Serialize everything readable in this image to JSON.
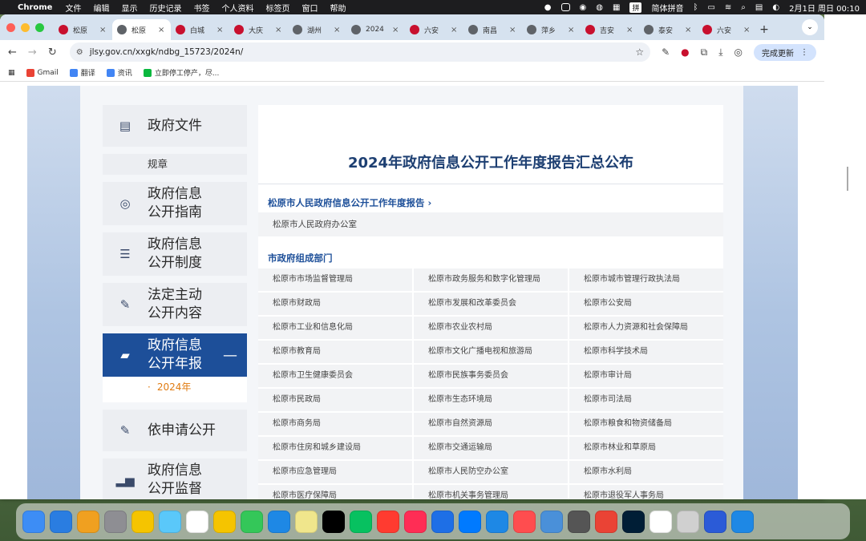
{
  "menubar": {
    "app_name": "Chrome",
    "menus": [
      "文件",
      "编辑",
      "显示",
      "历史记录",
      "书签",
      "个人资料",
      "标签页",
      "窗口",
      "帮助"
    ],
    "input_method": "拼",
    "input_label": "简体拼音",
    "clock": "2月1日 周日  00:10"
  },
  "tabs": [
    {
      "label": "松原",
      "color": "#c8102e"
    },
    {
      "label": "松原",
      "color": "#5f6368",
      "active": true
    },
    {
      "label": "白城",
      "color": "#c8102e"
    },
    {
      "label": "大庆",
      "color": "#c8102e"
    },
    {
      "label": "湖州",
      "color": "#5f6368"
    },
    {
      "label": "2024",
      "color": "#5f6368"
    },
    {
      "label": "六安",
      "color": "#c8102e"
    },
    {
      "label": "南昌",
      "color": "#5f6368"
    },
    {
      "label": "萍乡",
      "color": "#5f6368"
    },
    {
      "label": "吉安",
      "color": "#c8102e"
    },
    {
      "label": "泰安",
      "color": "#5f6368"
    },
    {
      "label": "六安",
      "color": "#c8102e"
    }
  ],
  "toolbar": {
    "url": "jlsy.gov.cn/xxgk/ndbg_15723/2024n/",
    "update_label": "完成更新"
  },
  "bookmarks": [
    {
      "label": "Gmail",
      "color": "#ea4335"
    },
    {
      "label": "翻译",
      "color": "#4285f4"
    },
    {
      "label": "资讯",
      "color": "#4285f4"
    },
    {
      "label": "立即停工停产，尽...",
      "color": "#09b83e"
    }
  ],
  "sidebar": {
    "items": [
      {
        "label_1": "政府文件",
        "label_2": "",
        "icon": "document-icon"
      },
      {
        "sub": "规章"
      },
      {
        "label_1": "政府信息",
        "label_2": "公开指南",
        "icon": "compass-icon"
      },
      {
        "label_1": "政府信息",
        "label_2": "公开制度",
        "icon": "list-icon"
      },
      {
        "label_1": "法定主动",
        "label_2": "公开内容",
        "icon": "edit-icon"
      },
      {
        "label_1": "政府信息",
        "label_2": "公开年报",
        "icon": "folder-icon",
        "active": true
      },
      {
        "year": "2024年"
      },
      {
        "label_1": "依申请公开",
        "label_2": "",
        "icon": "edit-icon"
      },
      {
        "label_1": "政府信息",
        "label_2": "公开监督",
        "icon": "chart-icon"
      }
    ]
  },
  "content": {
    "title": "2024年政府信息公开工作年度报告汇总公布",
    "section1_title": "松原市人民政府信息公开工作年度报告 ›",
    "section1_item": "松原市人民政府办公室",
    "section2_title": "市政府组成部门",
    "departments": [
      [
        "松原市市场监督管理局",
        "松原市政务服务和数字化管理局",
        "松原市城市管理行政执法局"
      ],
      [
        "松原市财政局",
        "松原市发展和改革委员会",
        "松原市公安局"
      ],
      [
        "松原市工业和信息化局",
        "松原市农业农村局",
        "松原市人力资源和社会保障局"
      ],
      [
        "松原市教育局",
        "松原市文化广播电视和旅游局",
        "松原市科学技术局"
      ],
      [
        "松原市卫生健康委员会",
        "松原市民族事务委员会",
        "松原市审计局"
      ],
      [
        "松原市民政局",
        "松原市生态环境局",
        "松原市司法局"
      ],
      [
        "松原市商务局",
        "松原市自然资源局",
        "松原市粮食和物资储备局"
      ],
      [
        "松原市住房和城乡建设局",
        "松原市交通运输局",
        "松原市林业和草原局"
      ],
      [
        "松原市应急管理局",
        "松原市人民防空办公室",
        "松原市水利局"
      ],
      [
        "松原市医疗保障局",
        "松原市机关事务管理局",
        "松原市退役军人事务局"
      ]
    ]
  },
  "dock_colors": [
    "#3d8df5",
    "#2a7de1",
    "#f0a020",
    "#8e8e93",
    "#f5c400",
    "#5ac8fa",
    "#ffffff",
    "#f5c400",
    "#34c759",
    "#1e88e5",
    "#f0e68c",
    "#000000",
    "#07c160",
    "#ff3b30",
    "#ff2d55",
    "#1e6fe6",
    "#007aff",
    "#1e88e5",
    "#ff4d4f",
    "#4a90d9",
    "#555555",
    "#ea4335",
    "#001e36",
    "#ffffff",
    "#d0d0d0",
    "#2b5bd7",
    "#1e88e5"
  ]
}
